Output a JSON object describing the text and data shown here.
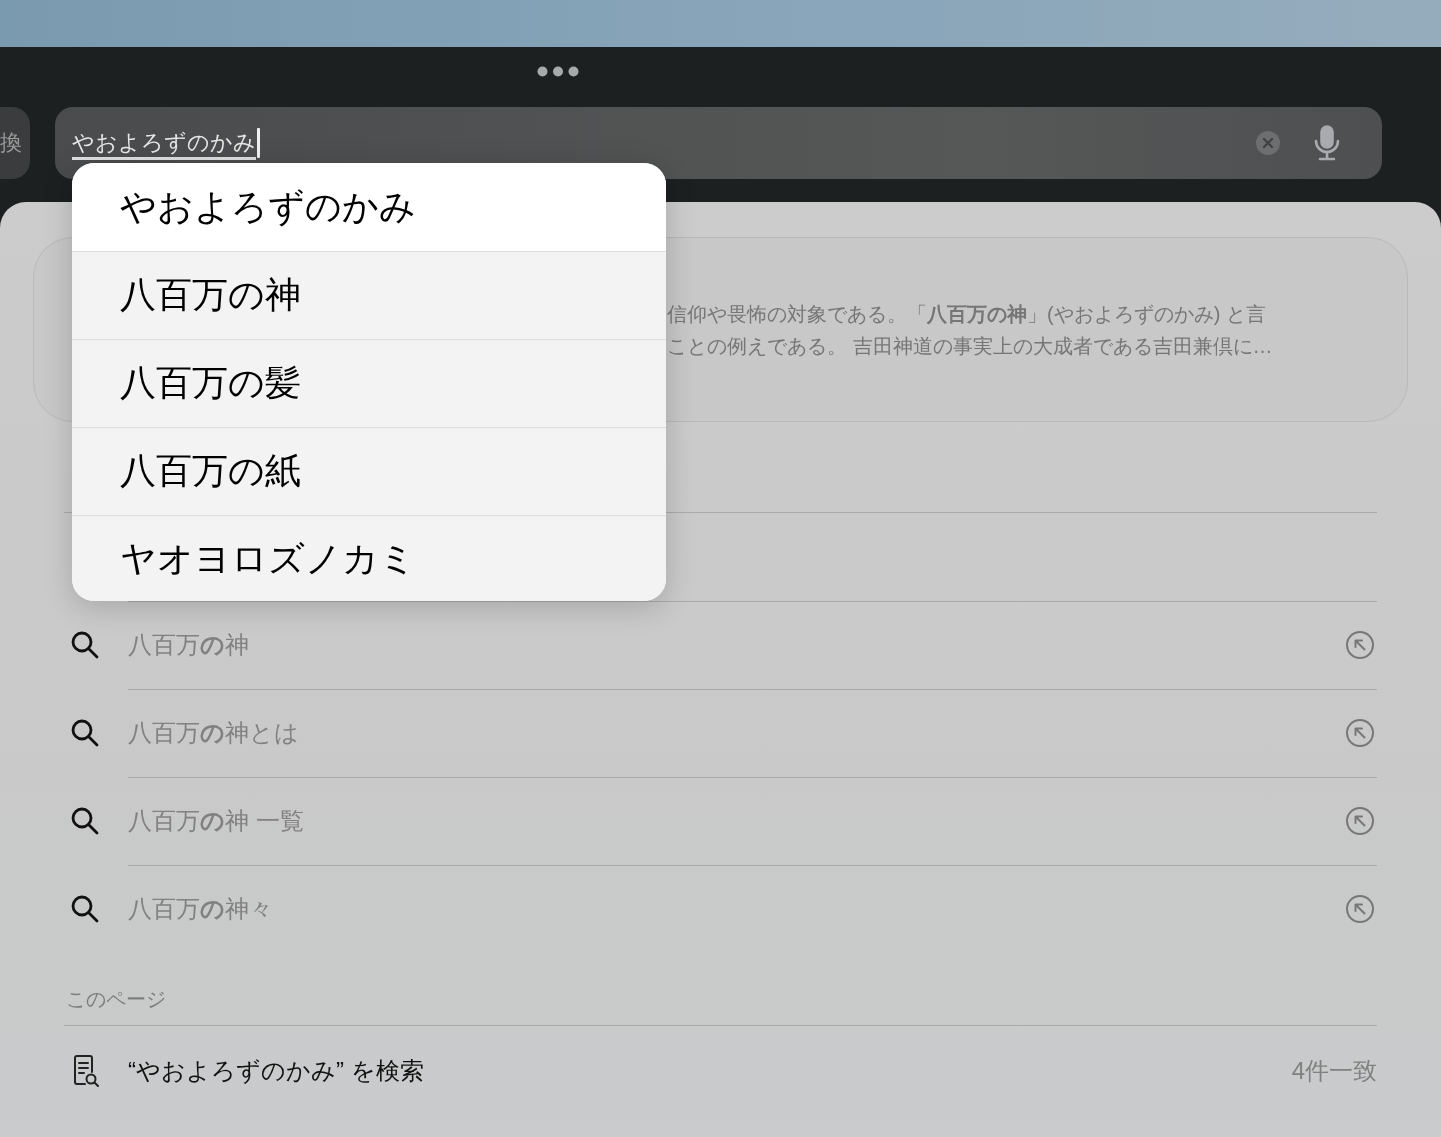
{
  "left_button": {
    "label": "換"
  },
  "search": {
    "value": "やおよろずのかみ",
    "composing": true
  },
  "candidates": [
    {
      "label": "やおよろずのかみ",
      "selected": true
    },
    {
      "label": "八百万の神",
      "selected": false
    },
    {
      "label": "八百万の髪",
      "selected": false
    },
    {
      "label": "八百万の紙",
      "selected": false
    },
    {
      "label": "ヤオヨロズノカミ",
      "selected": false
    }
  ],
  "summary_card": {
    "lines": [
      "信仰や畏怖の対象である。「**八百万の神**」(やおよろずのかみ) と言",
      "ことの例えである。 吉田神道の事実上の大成者である吉田兼倶に…"
    ]
  },
  "suggestions": [
    {
      "text": "八百万**の**神"
    },
    {
      "text": "八百万**の**神とは"
    },
    {
      "text": "八百万**の**神 一覧"
    },
    {
      "text": "八百万**の**神々"
    }
  ],
  "this_page": {
    "heading": "このページ",
    "find": {
      "text": "“やおよろずのかみ” を検索",
      "count": "4件一致"
    }
  }
}
